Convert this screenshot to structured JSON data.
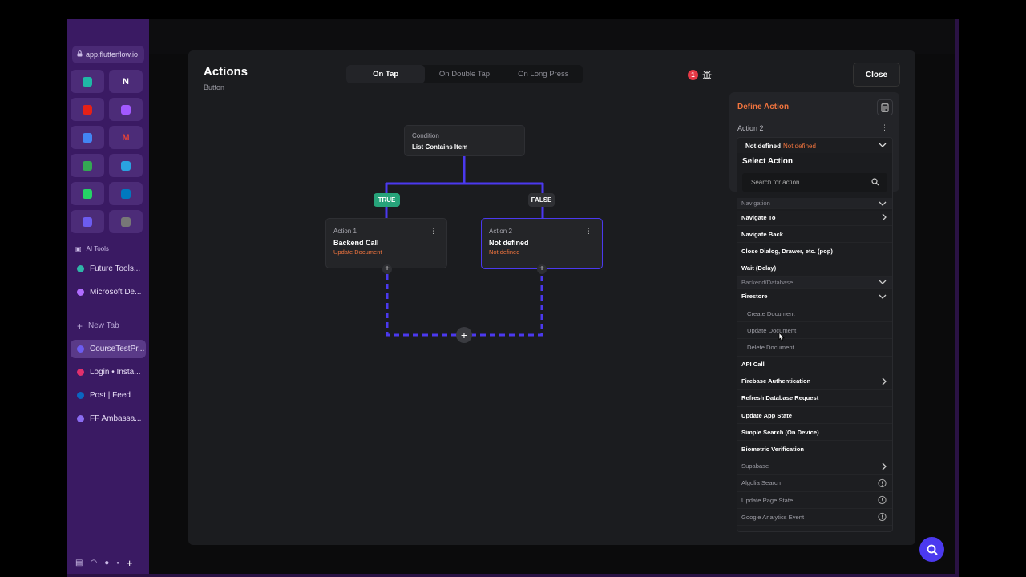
{
  "browser": {
    "url": "app.flutterflow.io",
    "section_label": "AI Tools",
    "tabs_top": [
      {
        "label": "Future Tools...",
        "color": "#2fb5a8"
      },
      {
        "label": "Microsoft De...",
        "color": "#b06cff"
      }
    ],
    "new_tab_label": "New Tab",
    "tabs_bottom": [
      {
        "label": "CourseTestPr...",
        "color": "#6c5cf0",
        "active": true
      },
      {
        "label": "Login • Insta...",
        "color": "#e1306c"
      },
      {
        "label": "Post | Feed",
        "color": "#0a66c2"
      },
      {
        "label": "FF Ambassa...",
        "color": "#8a6cf0"
      }
    ],
    "pins": [
      {
        "icon": "app-icon",
        "color": "#1fb8a6"
      },
      {
        "icon": "notion-icon",
        "glyph": "N",
        "color": "#ffffff"
      },
      {
        "icon": "youtube-icon",
        "color": "#e62117"
      },
      {
        "icon": "figma-icon",
        "color": "#a259ff"
      },
      {
        "icon": "calendar-icon",
        "color": "#4285f4"
      },
      {
        "icon": "gmail-icon",
        "glyph": "M",
        "color": "#ea4335"
      },
      {
        "icon": "chrome-icon",
        "color": "#34a853"
      },
      {
        "icon": "telegram-icon",
        "color": "#2aa3e0"
      },
      {
        "icon": "whatsapp-icon",
        "color": "#25d366"
      },
      {
        "icon": "trello-icon",
        "color": "#0079bf"
      },
      {
        "icon": "flutterflow-icon",
        "color": "#6c5cf0"
      },
      {
        "icon": "openai-icon",
        "color": "#777777"
      }
    ]
  },
  "modal": {
    "title": "Actions",
    "subtitle": "Button",
    "tabs": [
      "On Tap",
      "On Double Tap",
      "On Long Press"
    ],
    "active_tab": "On Tap",
    "error_count": "1",
    "close_label": "Close"
  },
  "flow": {
    "condition": {
      "small": "Condition",
      "title": "List Contains Item"
    },
    "true_label": "TRUE",
    "false_label": "FALSE",
    "action1": {
      "small": "Action 1",
      "title": "Backend Call",
      "sub": "Update Document"
    },
    "action2": {
      "small": "Action 2",
      "title": "Not defined",
      "sub": "Not defined"
    }
  },
  "define": {
    "title": "Define Action",
    "action_label": "Action 2",
    "selected_main": "Not defined",
    "selected_sub": "Not defined",
    "select_title": "Select Action",
    "search_placeholder": "Search for action..."
  },
  "actions_list": [
    {
      "label": "Navigation",
      "kind": "cat",
      "right": "chevron-down"
    },
    {
      "label": "Navigate To",
      "kind": "item",
      "right": "chevron-right"
    },
    {
      "label": "Navigate Back",
      "kind": "item"
    },
    {
      "label": "Close Dialog, Drawer, etc. (pop)",
      "kind": "item"
    },
    {
      "label": "Wait (Delay)",
      "kind": "item"
    },
    {
      "label": "Backend/Database",
      "kind": "cat",
      "right": "chevron-down"
    },
    {
      "label": "Firestore",
      "kind": "item",
      "right": "chevron-down"
    },
    {
      "label": "Create Document",
      "kind": "sub"
    },
    {
      "label": "Update Document",
      "kind": "sub"
    },
    {
      "label": "Delete Document",
      "kind": "sub"
    },
    {
      "label": "API Call",
      "kind": "item"
    },
    {
      "label": "Firebase Authentication",
      "kind": "item",
      "right": "chevron-right"
    },
    {
      "label": "Refresh Database Request",
      "kind": "item"
    },
    {
      "label": "Update App State",
      "kind": "item"
    },
    {
      "label": "Simple Search (On Device)",
      "kind": "item"
    },
    {
      "label": "Biometric Verification",
      "kind": "item"
    },
    {
      "label": "Supabase",
      "kind": "dim",
      "right": "chevron-right"
    },
    {
      "label": "Algolia Search",
      "kind": "dim",
      "right": "info"
    },
    {
      "label": "Update Page State",
      "kind": "dim",
      "right": "info"
    },
    {
      "label": "Google Analytics Event",
      "kind": "dim",
      "right": "info"
    }
  ],
  "colors": {
    "accent_orange": "#f0743e",
    "flow_blue": "#4b39ef",
    "true_green": "#27a37a",
    "sidebar_purple": "#3a1a63"
  }
}
